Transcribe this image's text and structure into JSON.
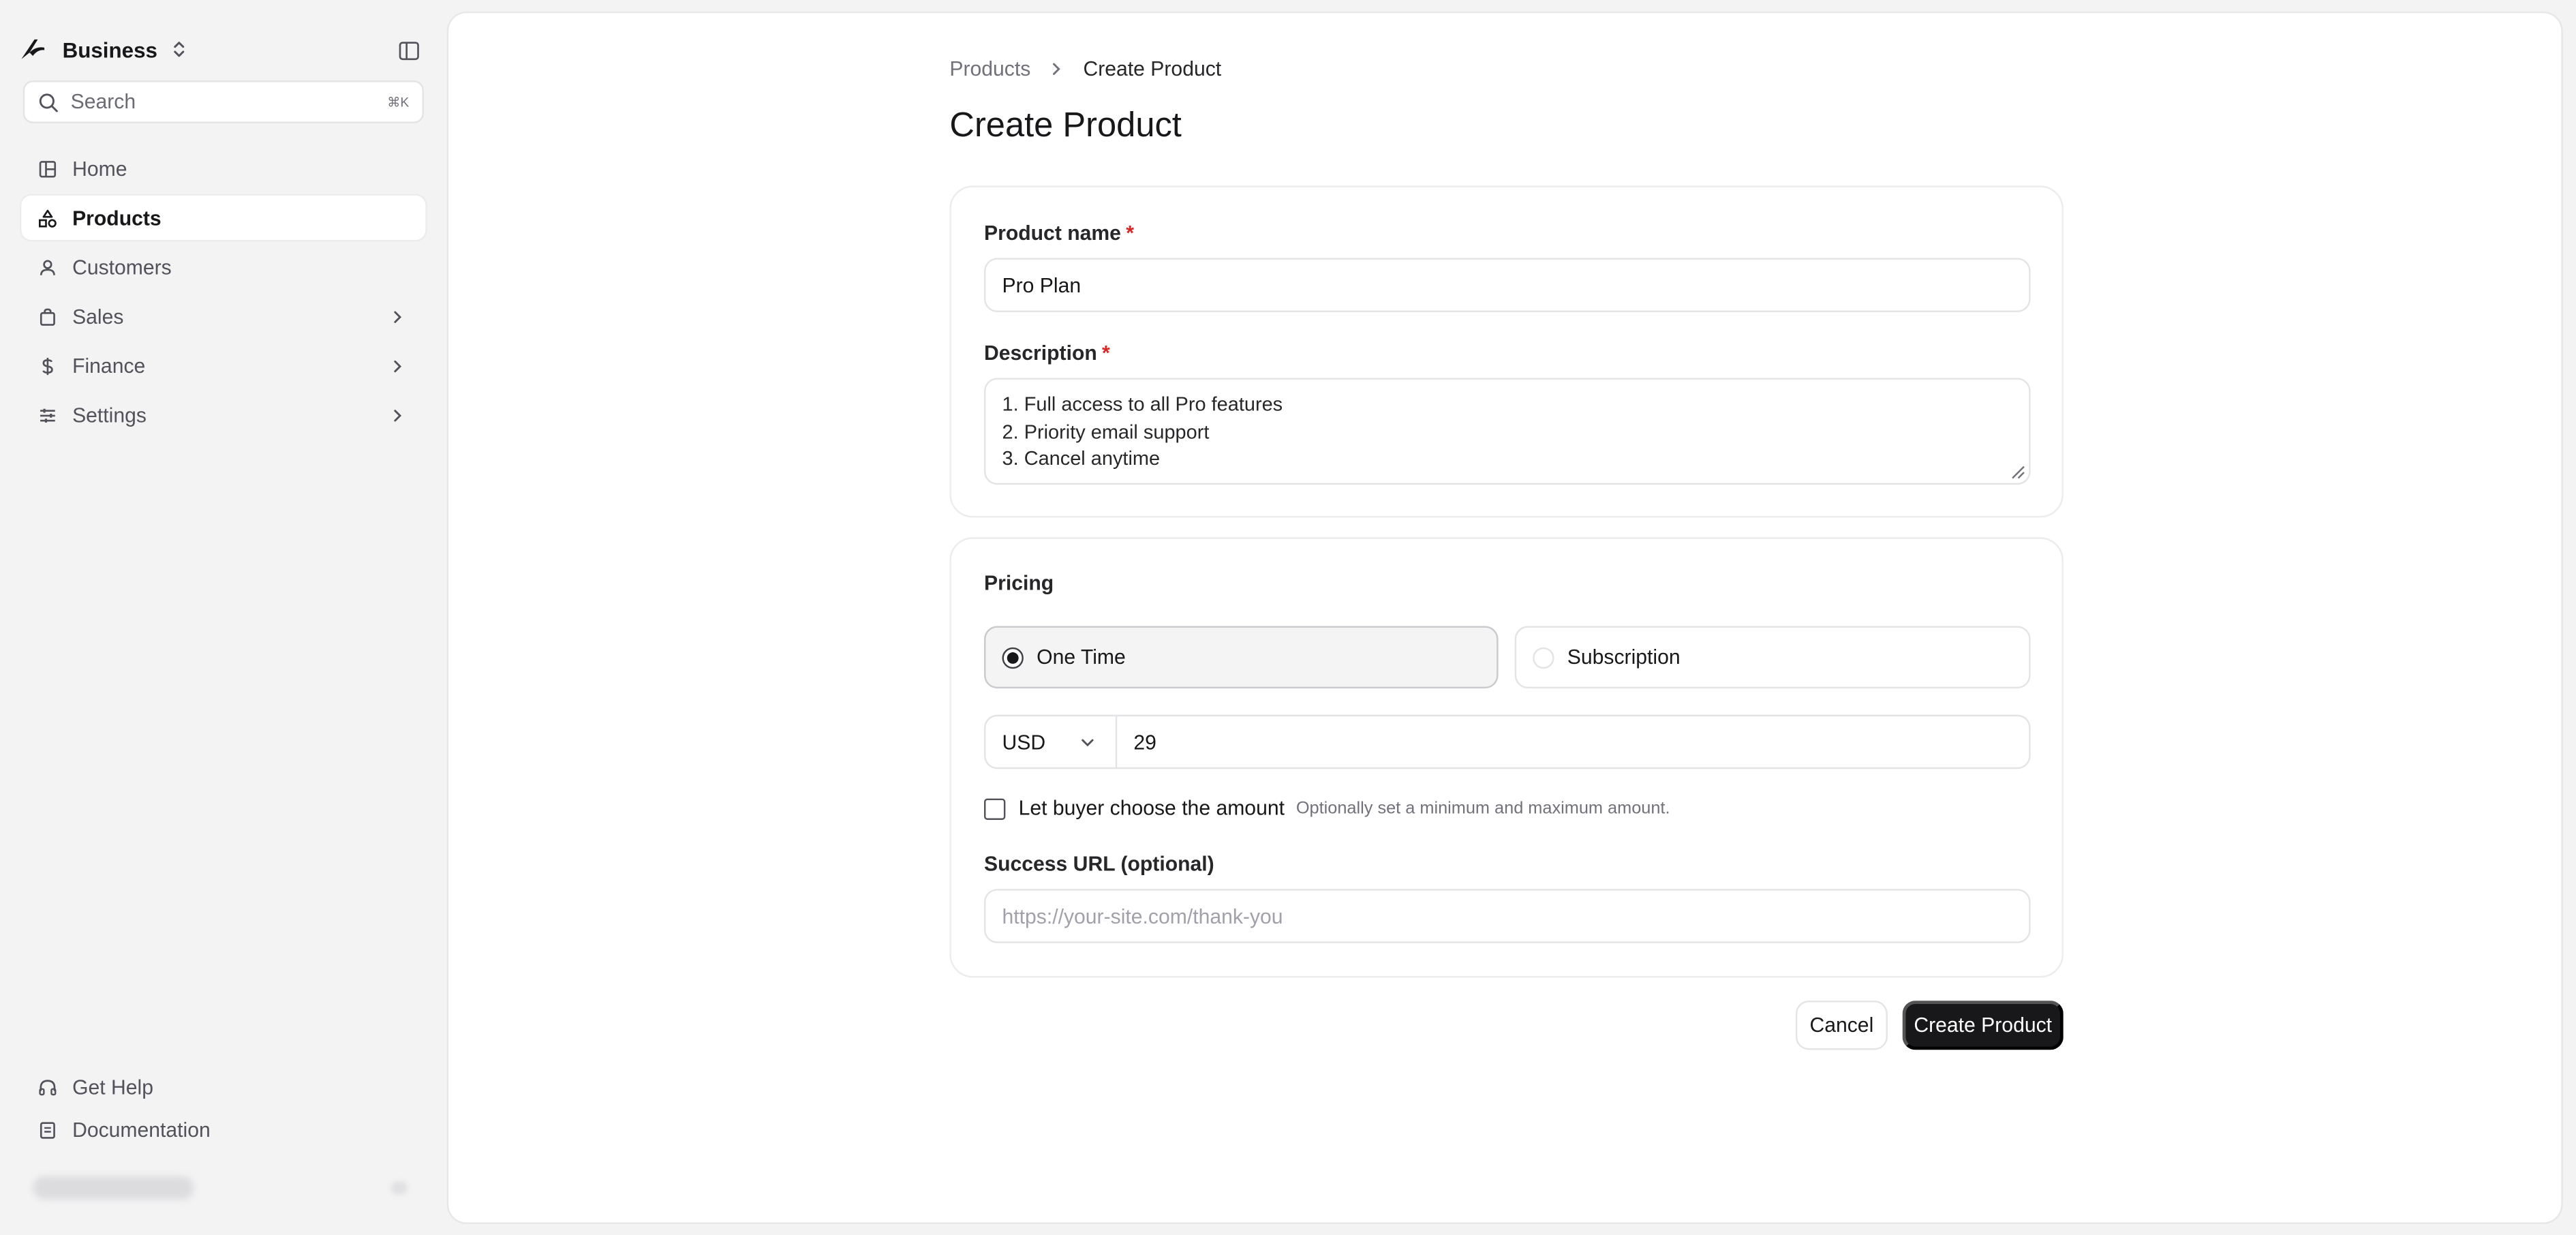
{
  "sidebar": {
    "brand": "Business",
    "search_placeholder": "Search",
    "search_shortcut": "⌘K",
    "items": [
      {
        "label": "Home",
        "icon": "layout-icon"
      },
      {
        "label": "Products",
        "icon": "shapes-icon",
        "active": true
      },
      {
        "label": "Customers",
        "icon": "user-icon"
      },
      {
        "label": "Sales",
        "icon": "shopping-bag-icon",
        "has_children": true
      },
      {
        "label": "Finance",
        "icon": "dollar-icon",
        "has_children": true
      },
      {
        "label": "Settings",
        "icon": "sliders-icon",
        "has_children": true
      }
    ],
    "footer": [
      {
        "label": "Get Help",
        "icon": "headphones-icon"
      },
      {
        "label": "Documentation",
        "icon": "book-icon"
      }
    ]
  },
  "breadcrumb": {
    "parent": "Products",
    "current": "Create Product"
  },
  "page_title": "Create Product",
  "form": {
    "product_name": {
      "label": "Product name",
      "value": "Pro Plan"
    },
    "description": {
      "label": "Description",
      "lines": [
        "1. Full access to all Pro features",
        "2. Priority email support",
        "3. Cancel anytime"
      ]
    },
    "pricing": {
      "label": "Pricing",
      "options": [
        {
          "label": "One Time",
          "selected": true
        },
        {
          "label": "Subscription",
          "selected": false
        }
      ],
      "currency": "USD",
      "amount": "29",
      "buyer_choose_label": "Let buyer choose the amount",
      "buyer_choose_hint": "Optionally set a minimum and maximum amount.",
      "buyer_choose_checked": false
    },
    "success_url": {
      "label": "Success URL (optional)",
      "placeholder": "https://your-site.com/thank-you"
    }
  },
  "actions": {
    "cancel": "Cancel",
    "create": "Create Product"
  },
  "colors": {
    "primary": "#18181b",
    "required": "#dc2626",
    "background": "#f3f3f4"
  }
}
